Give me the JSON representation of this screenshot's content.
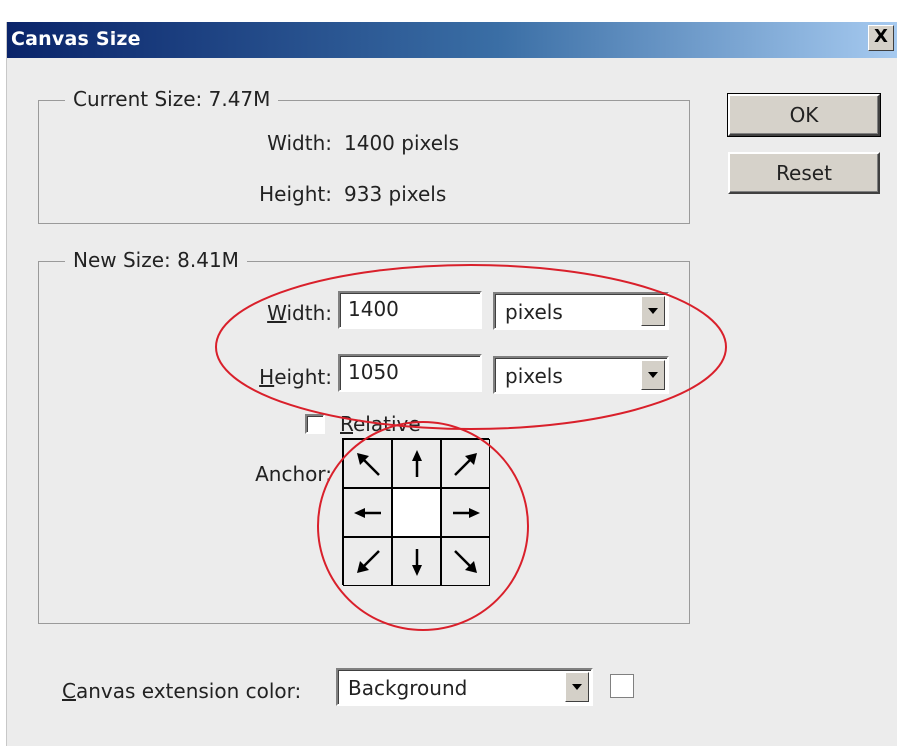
{
  "window": {
    "title": "Canvas Size",
    "close_glyph": "X"
  },
  "current_size": {
    "legend": "Current Size: 7.47M",
    "width_label": "Width:",
    "width_value": "1400 pixels",
    "height_label": "Height:",
    "height_value": "933 pixels"
  },
  "new_size": {
    "legend": "New Size: 8.41M",
    "width_label_first": "W",
    "width_label_rest": "idth:",
    "width_value": "1400",
    "width_unit": "pixels",
    "height_label_first": "H",
    "height_label_rest": "eight:",
    "height_value": "1050",
    "height_unit": "pixels",
    "relative_first": "R",
    "relative_rest": "elative",
    "relative_checked": false,
    "anchor_label": "Anchor:",
    "anchor_cells": [
      "arrow-up-left-icon",
      "arrow-up-icon",
      "arrow-up-right-icon",
      "arrow-left-icon",
      "anchor-center",
      "arrow-right-icon",
      "arrow-down-left-icon",
      "arrow-down-icon",
      "arrow-down-right-icon"
    ]
  },
  "buttons": {
    "ok": "OK",
    "reset": "Reset"
  },
  "extension": {
    "label_first": "C",
    "label_rest": "anvas extension color:",
    "value": "Background",
    "swatch_color": "#ffffff"
  },
  "colors": {
    "title_gradient_start": "#0a246a",
    "title_gradient_end": "#a6caf0",
    "dialog_bg": "#ececec",
    "annotation_red": "#d9202b"
  }
}
